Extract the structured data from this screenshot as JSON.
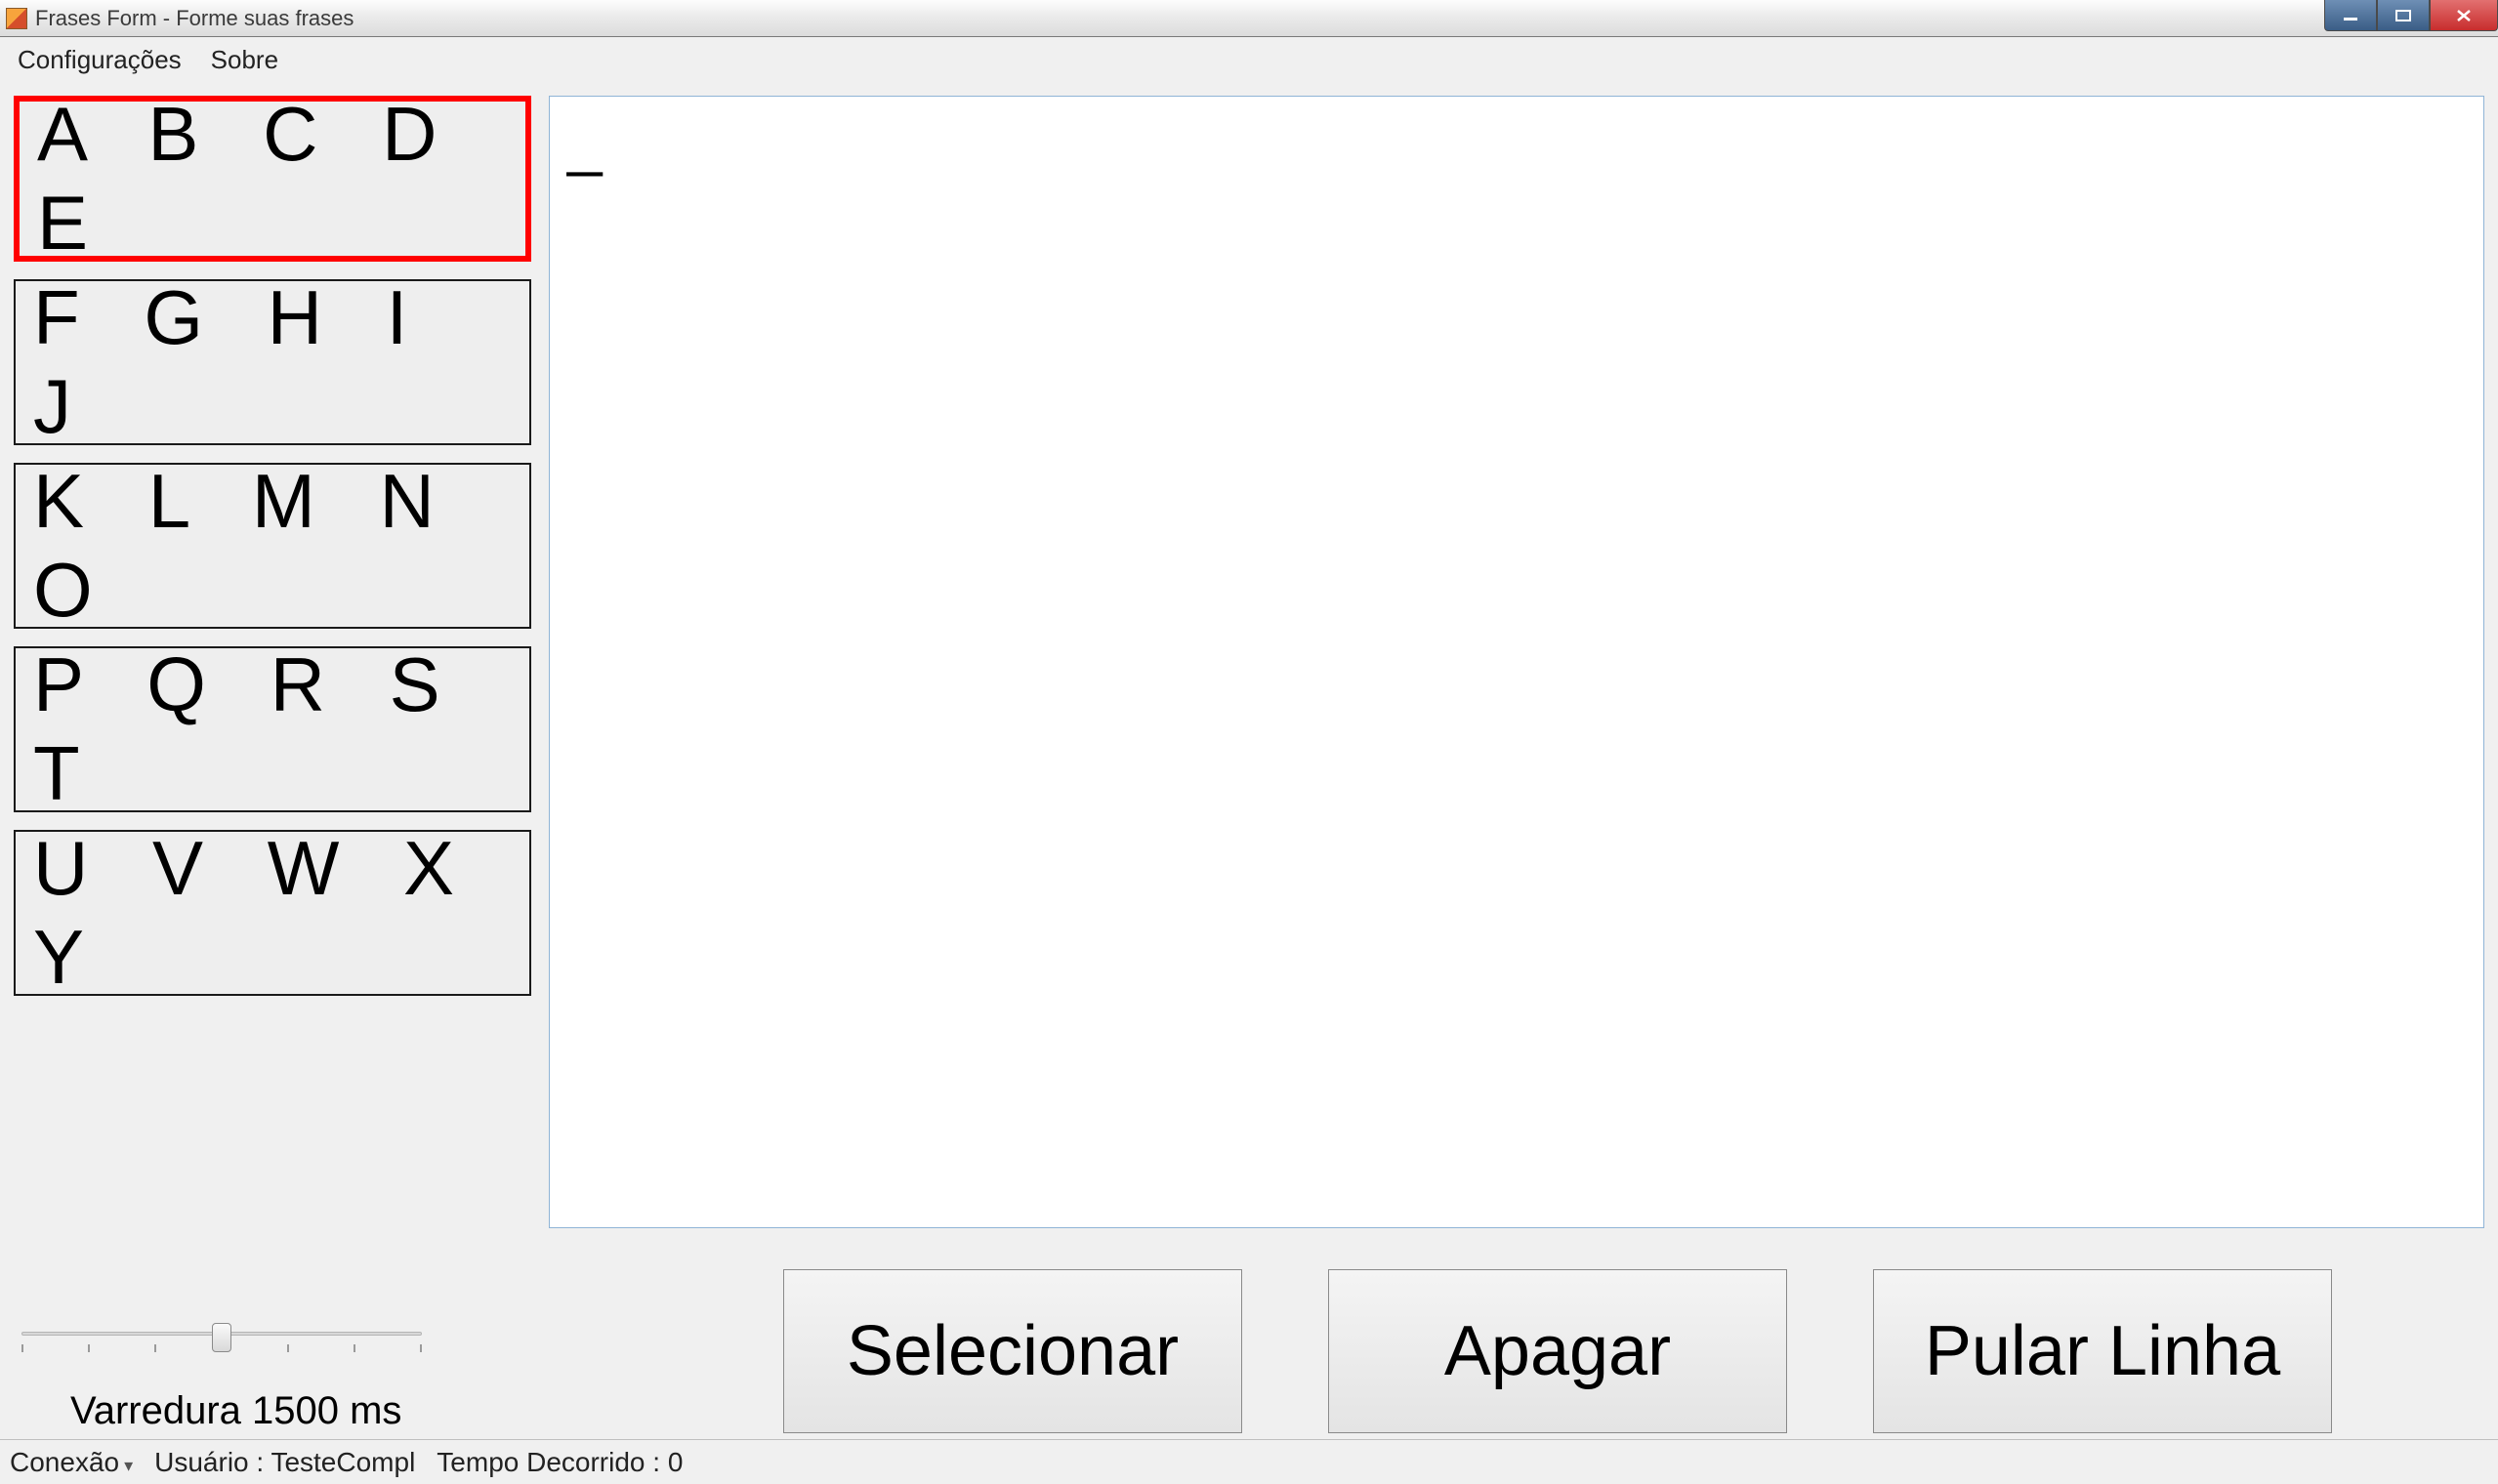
{
  "window": {
    "title": "Frases Form - Forme suas frases"
  },
  "menu": {
    "configuracoes": "Configurações",
    "sobre": "Sobre"
  },
  "letter_groups": [
    {
      "label": "A B C D E",
      "selected": true
    },
    {
      "label": "F G H I J",
      "selected": false
    },
    {
      "label": "K L M N O",
      "selected": false
    },
    {
      "label": "P Q R S T",
      "selected": false
    },
    {
      "label": "U V W X Y",
      "selected": false
    }
  ],
  "output_text": "_",
  "slider": {
    "label": "Varredura 1500 ms"
  },
  "buttons": {
    "select": "Selecionar",
    "erase": "Apagar",
    "newline": "Pular Linha"
  },
  "status": {
    "connection": "Conexão",
    "user": "Usuário : TesteCompl",
    "elapsed": "Tempo Decorrido : 0"
  }
}
